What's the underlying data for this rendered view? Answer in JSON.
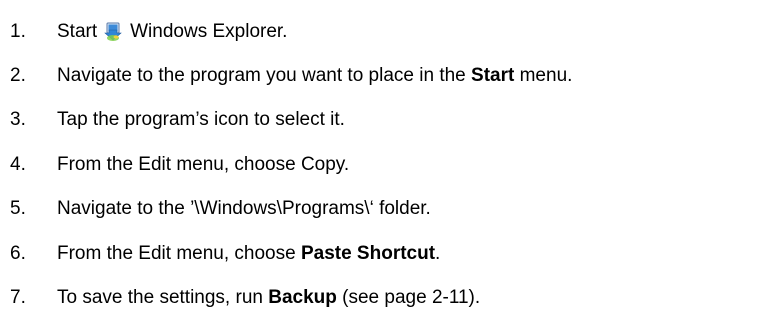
{
  "steps": [
    {
      "num": "1.",
      "pre": "Start",
      "icon": "windows-explorer-icon",
      "post": "Windows Explorer."
    },
    {
      "num": "2.",
      "pre": "Navigate to the program you want to place in the ",
      "bold": "Start",
      "post": " menu."
    },
    {
      "num": "3.",
      "text": "Tap the program’s icon to select it."
    },
    {
      "num": "4.",
      "text": "From the Edit menu, choose Copy."
    },
    {
      "num": "5.",
      "text": "Navigate to the ’\\Windows\\Programs\\‘ folder."
    },
    {
      "num": "6.",
      "pre": "From the Edit menu, choose ",
      "bold": "Paste Shortcut",
      "post": "."
    },
    {
      "num": "7.",
      "pre": "To save the settings, run ",
      "bold": "Backup",
      "post": " (see page 2-11)."
    }
  ]
}
